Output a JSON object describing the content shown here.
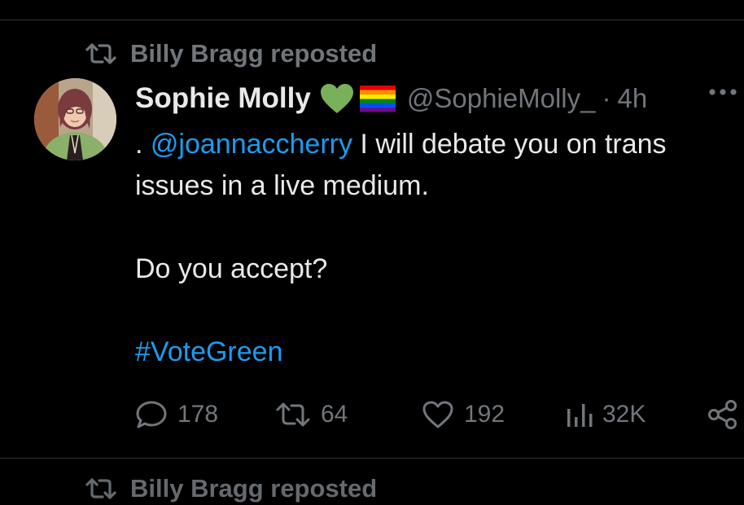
{
  "repost_banner": {
    "label": "Billy Bragg reposted"
  },
  "next_repost_banner": {
    "label": "Billy Bragg reposted"
  },
  "tweet": {
    "author": {
      "display_name": "Sophie Molly",
      "handle": "@SophieMolly_"
    },
    "separator": "·",
    "time": "4h",
    "text": {
      "prefix": ". ",
      "mention": "@joannaccherry",
      "line1_rest": " I will debate you on trans",
      "line2": "issues in a live medium.",
      "line3": "Do you accept?",
      "hashtag": "#VoteGreen"
    },
    "stats": {
      "replies": "178",
      "reposts": "64",
      "likes": "192",
      "views": "32K"
    }
  },
  "icons": {
    "repost": "repost-icon",
    "more": "more-icon",
    "reply": "reply-icon",
    "like": "heart-icon",
    "views": "views-icon",
    "share": "share-icon",
    "heart_emoji": "green-heart-emoji",
    "flag_emoji": "rainbow-flag-emoji"
  },
  "colors": {
    "background": "#000000",
    "text": "#e7e9ea",
    "muted": "#71767b",
    "link": "#1d9bf0",
    "divider": "#2f3336"
  }
}
